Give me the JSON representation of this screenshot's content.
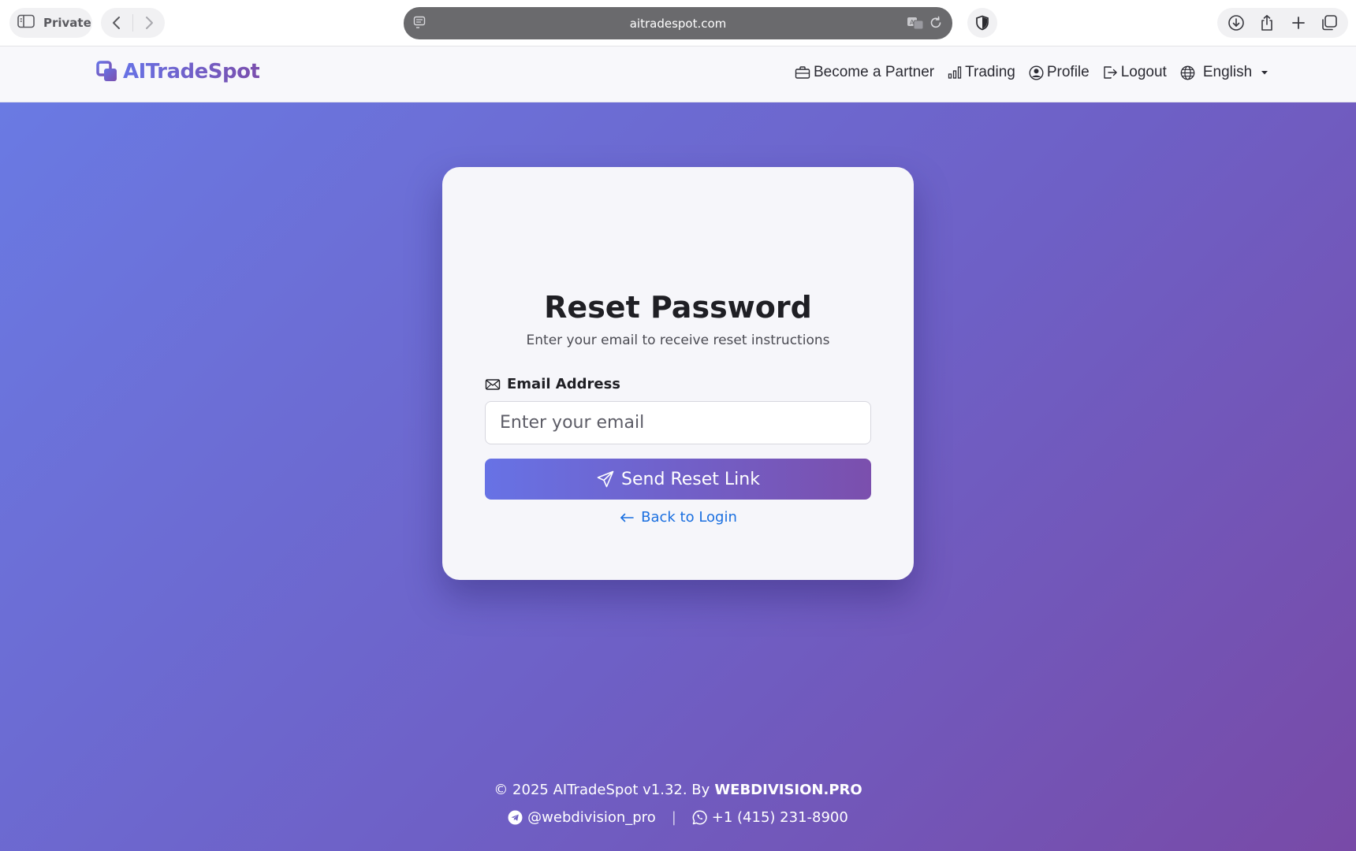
{
  "browser": {
    "private_label": "Private",
    "url": "aitradespot.com"
  },
  "header": {
    "logo_text": "AITradeSpot",
    "nav": {
      "partner": "Become a Partner",
      "trading": "Trading",
      "profile": "Profile",
      "logout": "Logout",
      "language": "English"
    }
  },
  "card": {
    "title": "Reset Password",
    "subtitle": "Enter your email to receive reset instructions",
    "email_label": "Email Address",
    "email_placeholder": "Enter your email",
    "email_value": "",
    "submit_label": "Send Reset Link",
    "back_label": "Back to Login"
  },
  "footer": {
    "copyright": "© 2025 AITradeSpot v1.32. By",
    "company": "WEBDIVISION.PRO",
    "telegram": "@webdivision_pro",
    "separator": "|",
    "phone": "+1 (415) 231-8900"
  },
  "colors": {
    "gradient_start": "#6772e5",
    "gradient_end": "#7b4fad",
    "link": "#1a6fe0"
  }
}
